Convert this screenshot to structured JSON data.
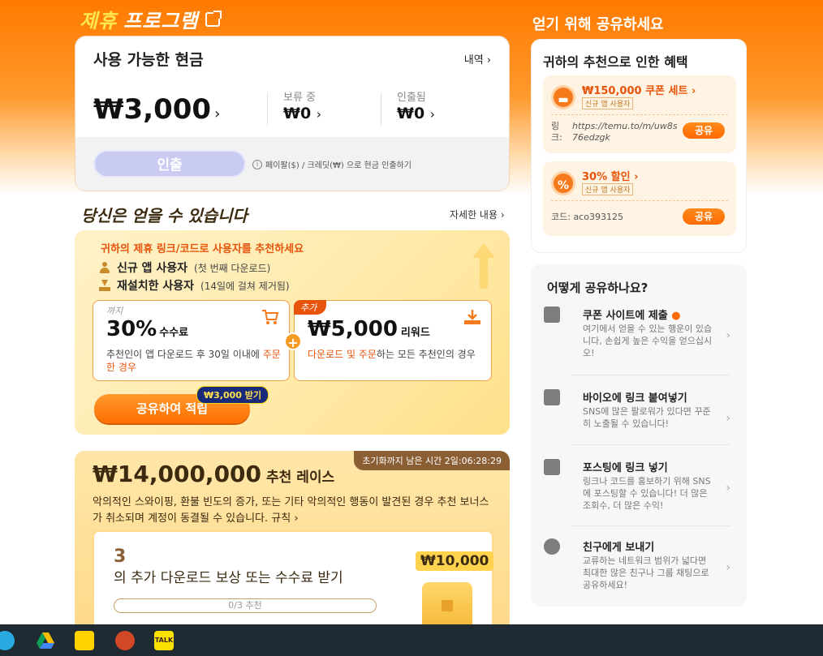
{
  "header": {
    "title_highlight": "제휴",
    "title_rest": "프로그램"
  },
  "cash": {
    "title": "사용 가능한 현금",
    "history_link": "내역",
    "available": "₩3,000",
    "pending_label": "보류 중",
    "pending_value": "₩0",
    "withdrawn_label": "인출됨",
    "withdrawn_value": "₩0",
    "withdraw_button": "인출",
    "withdraw_note": "페이팔($) / 크레딧(₩) 으로 현금 인출하기"
  },
  "earn": {
    "title": "당신은 얻을 수 있습니다",
    "details_link": "자세한 내용",
    "headline": "귀하의 제휴 링크/코드로 사용자를 추천하세요",
    "row1_bold": "신규 앱 사용자",
    "row1_note": "(첫 번째 다운로드)",
    "row2_bold": "재설치한 사용자",
    "row2_note": "(14일에 걸쳐 제거됨)",
    "box_a": {
      "upto": "까지",
      "percent": "30%",
      "percent_suffix": "수수료",
      "desc_prefix": "추천인이 앱 다운로드 후 30일 이내에 ",
      "desc_highlight": "주문한 경우"
    },
    "box_b": {
      "tag": "추가",
      "amount": "₩5,000",
      "amount_suffix": "리워드",
      "desc_highlight": "다운로드 및 주문",
      "desc_suffix": "하는 모든 추천인의 경우"
    },
    "plus": "+",
    "share_button": "공유하여 적립",
    "get_badge": "₩3,000 받기"
  },
  "race": {
    "timer": "초기화까지 남은 시간 2일:06:28:29",
    "amount": "₩14,000,000",
    "amount_suffix": "추천 레이스",
    "desc": "악의적인 스와이핑, 환불 빈도의 증가, 또는 기타 악의적인 행동이 발견된 경우 추천 보너스가 취소되며 계정이 동결될 수 있습니다.",
    "rules_link": "규칙",
    "count": "3",
    "sub": "의 추가 다운로드 보상 또는 수수료 받기",
    "progress": "0/3 추천",
    "prize": "₩10,000"
  },
  "share_panel": {
    "title": "얻기 위해 공유하세요",
    "benefit_title": "귀하의 추천으로 인한 혜택",
    "coupon": {
      "head": "₩150,000 쿠폰 세트",
      "tag": "신규 앱 사용자",
      "link_label": "링크:",
      "url": "https://temu.to/m/uw8s76edzgk",
      "share": "공유"
    },
    "discount": {
      "head": "30% 할인",
      "tag": "신규 앱 사용자",
      "code": "코드: aco393125",
      "share": "공유"
    }
  },
  "how": {
    "title": "어떻게 공유하나요?",
    "items": [
      {
        "head": "쿠폰 사이트에 제출",
        "desc": "여기에서 얻을 수 있는 행운이 있습니다, 손쉽게 높은 수익을 얻으십시오!"
      },
      {
        "head": "바이오에 링크 붙여넣기",
        "desc": "SNS에 많은 팔로워가 있다면 꾸준히 노출될 수 있습니다!"
      },
      {
        "head": "포스팅에 링크 넣기",
        "desc": "링크나 코드를 홍보하기 위해 SNS에 포스팅할 수 있습니다! 더 많은 조회수, 더 많은 수익!"
      },
      {
        "head": "친구에게 보내기",
        "desc": "교류하는 네트워크 범위가 넓다면 최대한 많은 친구나 그룹 채팅으로 공유하세요!"
      }
    ]
  },
  "taskbar": {
    "kakao_label": "TALK"
  }
}
